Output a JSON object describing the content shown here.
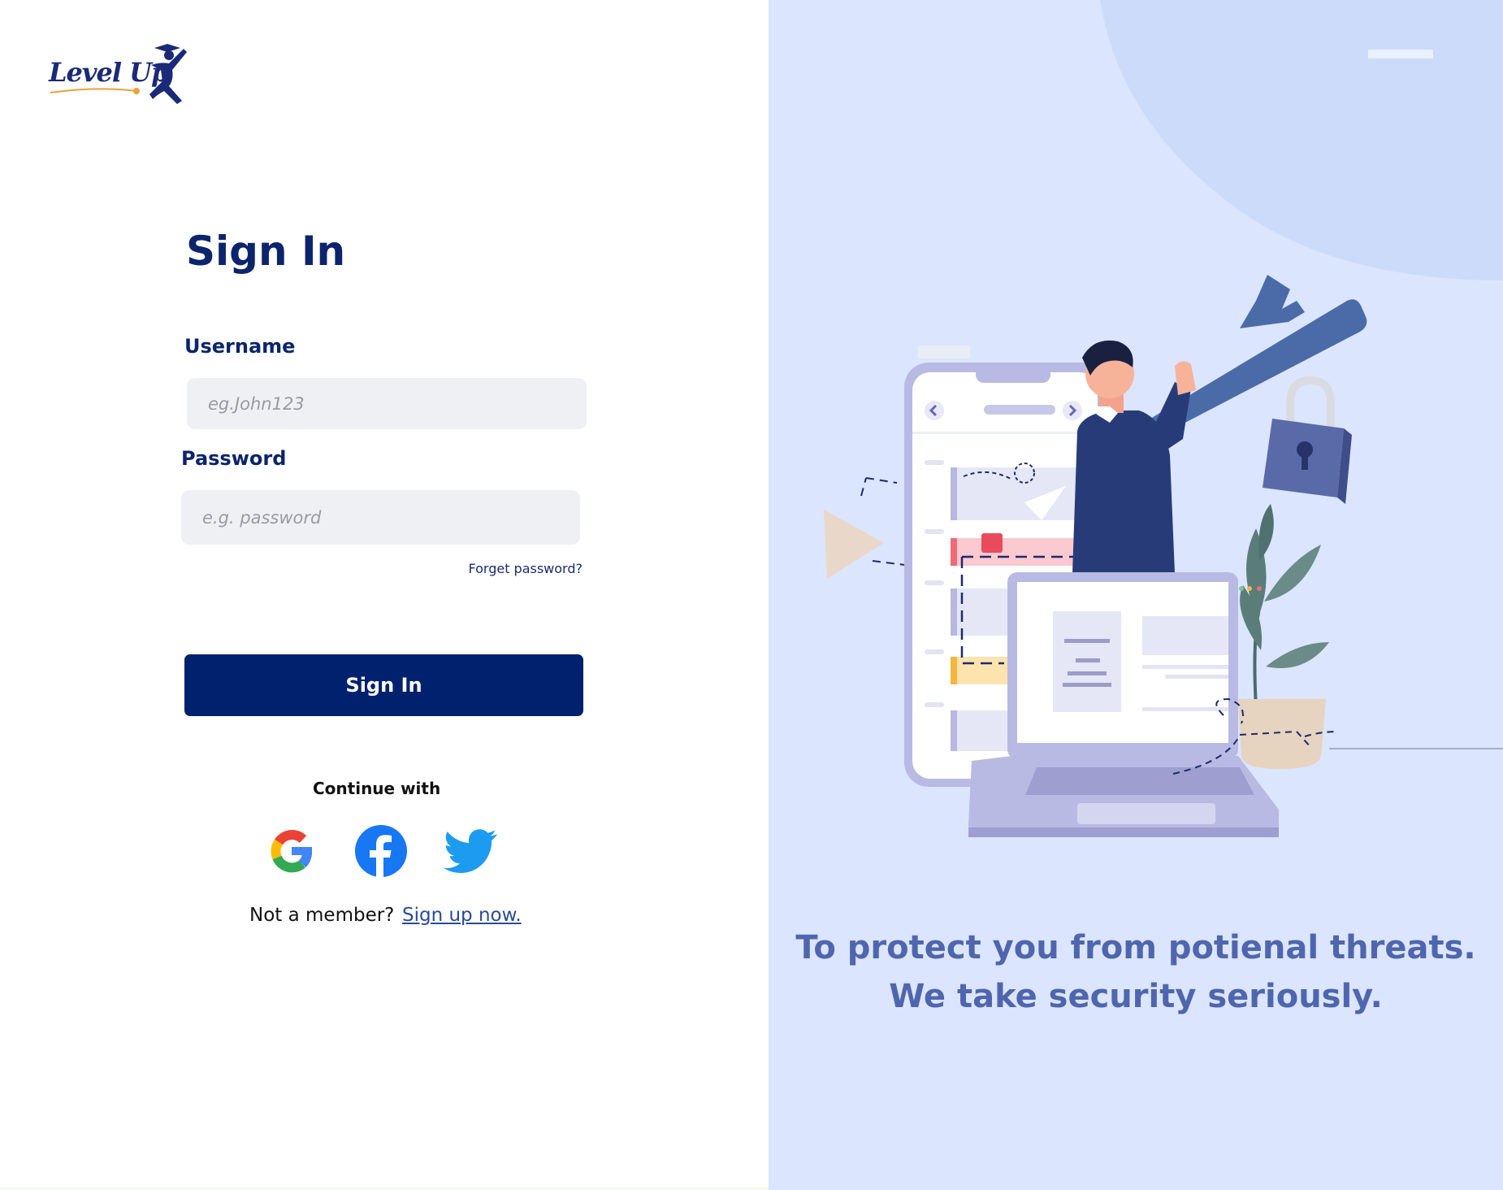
{
  "brand": {
    "logo_text": "Level Up"
  },
  "signin": {
    "title": "Sign In",
    "username_label": "Username",
    "username_placeholder": "eg.John123",
    "password_label": "Password",
    "password_placeholder": "e.g. password",
    "forgot_link": "Forget password?",
    "submit_label": "Sign In"
  },
  "social": {
    "continue_label": "Continue with",
    "providers": [
      "google-icon",
      "facebook-icon",
      "twitter-icon"
    ]
  },
  "footer": {
    "member_text": "Not a member?",
    "signup_link": "Sign up now."
  },
  "hero": {
    "line1": "To protect you from potienal threats.",
    "line2": "We take security seriously."
  },
  "colors": {
    "primary": "#00216e",
    "heading": "#0c246c",
    "hero_bg": "#dbe5fd",
    "hero_text": "#4f66ae",
    "input_bg": "#eff0f4"
  }
}
